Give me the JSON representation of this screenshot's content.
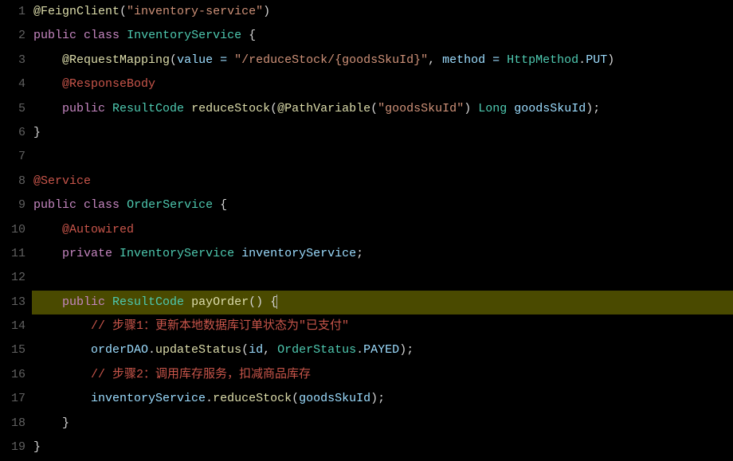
{
  "lines": {
    "l1": {
      "no": "1"
    },
    "l2": {
      "no": "2"
    },
    "l3": {
      "no": "3"
    },
    "l4": {
      "no": "4"
    },
    "l5": {
      "no": "5"
    },
    "l6": {
      "no": "6"
    },
    "l7": {
      "no": "7"
    },
    "l8": {
      "no": "8"
    },
    "l9": {
      "no": "9"
    },
    "l10": {
      "no": "10"
    },
    "l11": {
      "no": "11"
    },
    "l12": {
      "no": "12"
    },
    "l13": {
      "no": "13"
    },
    "l14": {
      "no": "14"
    },
    "l15": {
      "no": "15"
    },
    "l16": {
      "no": "16"
    },
    "l17": {
      "no": "17"
    },
    "l18": {
      "no": "18"
    },
    "l19": {
      "no": "19"
    }
  },
  "tok": {
    "at_feign": "@FeignClient",
    "lp": "(",
    "rp": ")",
    "inv_svc_str": "\"inventory-service\"",
    "public": "public",
    "class": "class",
    "InventoryService": "InventoryService",
    "lb": " {",
    "rb_only": "}",
    "at_reqmap": "@RequestMapping",
    "value_eq": "value = ",
    "reduce_path": "\"/reduceStock/{goodsSkuId}\"",
    "comma_sp": ", ",
    "method_eq": "method = ",
    "HttpMethod": "HttpMethod",
    "dot": ".",
    "PUT": "PUT",
    "at_respbody": "@ResponseBody",
    "ResultCode": "ResultCode",
    "reduceStock": "reduceStock",
    "at_pathvar": "@PathVariable",
    "goodsSkuId_str": "\"goodsSkuId\"",
    "Long": "Long",
    "goodsSkuId": "goodsSkuId",
    "semicolon": ";",
    "at_service": "@Service",
    "OrderService": "OrderService",
    "at_autowired": "@Autowired",
    "private": "private",
    "inventoryService_var": "inventoryService",
    "payOrder": "payOrder",
    "empty_params": "()",
    "lb_cursor": " {",
    "cmt1": "// 步骤1：更新本地数据库订单状态为\"已支付\"",
    "orderDAO": "orderDAO",
    "updateStatus": "updateStatus",
    "id": "id",
    "OrderStatus": "OrderStatus",
    "PAYED": "PAYED",
    "cmt2": "// 步骤2：调用库存服务，扣减商品库存",
    "sp": " "
  }
}
